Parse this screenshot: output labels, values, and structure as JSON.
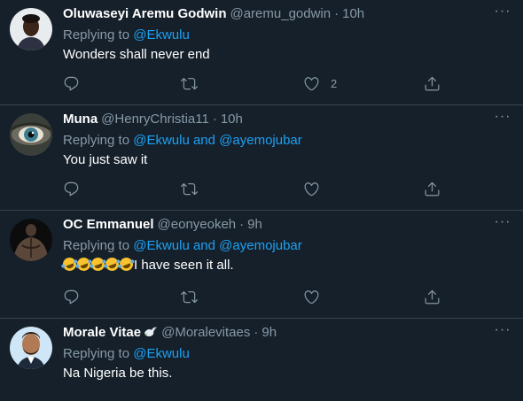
{
  "tweets": [
    {
      "name": "Oluwaseyi Aremu Godwin",
      "handle": "@aremu_godwin",
      "time": "10h",
      "replying_prefix": "Replying to",
      "replying_to": "@Ekwulu",
      "text": "Wonders shall never end",
      "like_count": "2"
    },
    {
      "name": "Muna",
      "handle": "@HenryChristia11",
      "time": "10h",
      "replying_prefix": "Replying to",
      "replying_to": "@Ekwulu and @ayemojubar",
      "text": "You just saw it",
      "like_count": ""
    },
    {
      "name": "OC Emmanuel",
      "handle": "@eonyeokeh",
      "time": "9h",
      "replying_prefix": "Replying to",
      "replying_to": "@Ekwulu and @ayemojubar",
      "text": "I have seen it all.",
      "emoji_count": 5,
      "emoji_name": "rolling-on-the-floor-laughing",
      "like_count": ""
    },
    {
      "name": "Morale Vitae",
      "name_badge": "dove-emoji",
      "handle": "@Moralevitaes",
      "time": "9h",
      "replying_prefix": "Replying to",
      "replying_to": "@Ekwulu",
      "text": "Na Nigeria be this.",
      "like_count": ""
    }
  ],
  "separator": "·",
  "more_label": "···",
  "icons": {
    "reply": "reply-icon",
    "retweet": "retweet-icon",
    "like": "heart-icon",
    "share": "share-icon",
    "more": "more-icon"
  },
  "colors": {
    "background": "#15202b",
    "border": "#38444d",
    "secondary_text": "#8899a6",
    "link": "#1da1f2",
    "primary_text": "#ffffff"
  }
}
